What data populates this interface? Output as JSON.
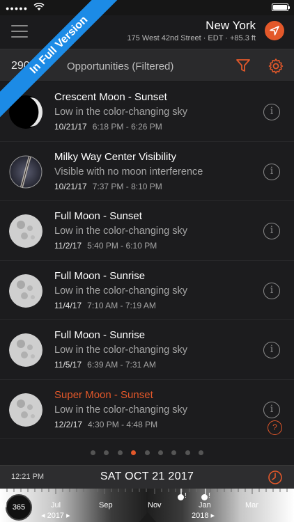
{
  "header": {
    "location": "New York",
    "address": "175 West 42nd Street · EDT · +85.3 ft"
  },
  "filter_bar": {
    "count": "290",
    "label": "Opportunities (Filtered)"
  },
  "banner": {
    "text": "In Full Version"
  },
  "items": [
    {
      "title": "Crescent Moon - Sunset",
      "desc": "Low in the color-changing sky",
      "date": "10/21/17",
      "time": "6:18 PM - 6:26 PM",
      "kind": "crescent"
    },
    {
      "title": "Milky Way Center Visibility",
      "desc": "Visible with no moon interference",
      "date": "10/21/17",
      "time": "7:37 PM - 8:10 PM",
      "kind": "milkyway"
    },
    {
      "title": "Full Moon - Sunset",
      "desc": "Low in the color-changing sky",
      "date": "11/2/17",
      "time": "5:40 PM - 6:10 PM",
      "kind": "full"
    },
    {
      "title": "Full Moon - Sunrise",
      "desc": "Low in the color-changing sky",
      "date": "11/4/17",
      "time": "7:10 AM - 7:19 AM",
      "kind": "full"
    },
    {
      "title": "Full Moon - Sunrise",
      "desc": "Low in the color-changing sky",
      "date": "11/5/17",
      "time": "6:39 AM - 7:31 AM",
      "kind": "full"
    },
    {
      "title": "Super Moon - Sunset",
      "desc": "Low in the color-changing sky",
      "date": "12/2/17",
      "time": "4:30 PM - 4:48 PM",
      "kind": "full",
      "highlight": true
    }
  ],
  "pagination": {
    "total": 9,
    "active": 3
  },
  "date_bar": {
    "time": "12:21 PM",
    "date": "SAT OCT 21 2017"
  },
  "timeline": {
    "badge": "365",
    "months": [
      "M",
      "Jul",
      "Sep",
      "Nov",
      "Jan",
      "Mar"
    ],
    "years": [
      "◂ 2017 ▸",
      "2018 ▸"
    ]
  },
  "colors": {
    "accent": "#e3582a",
    "banner": "#1c8be6"
  }
}
